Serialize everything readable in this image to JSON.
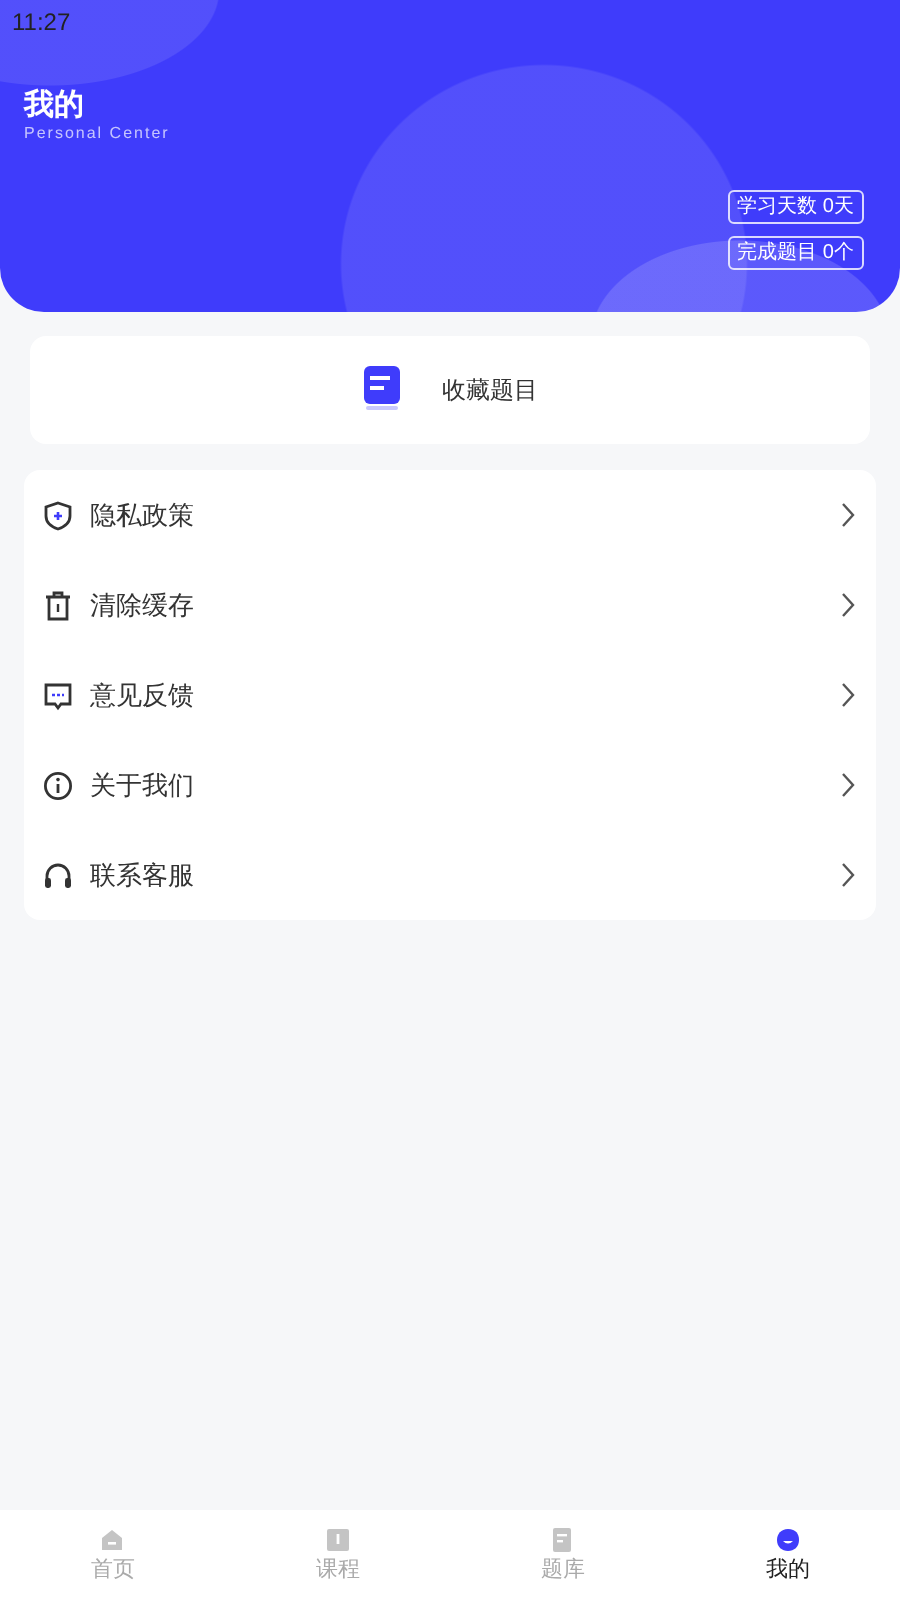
{
  "status_bar": {
    "time": "11:27"
  },
  "header": {
    "title": "我的",
    "subtitle": "Personal Center",
    "stats": [
      "学习天数 0天",
      "完成题目 0个"
    ]
  },
  "favorites": {
    "label": "收藏题目"
  },
  "menu": [
    {
      "kind": "shield",
      "label": "隐私政策"
    },
    {
      "kind": "trash",
      "label": "清除缓存"
    },
    {
      "kind": "chat",
      "label": "意见反馈"
    },
    {
      "kind": "info",
      "label": "关于我们"
    },
    {
      "kind": "headset",
      "label": "联系客服"
    }
  ],
  "tabs": [
    {
      "kind": "home",
      "label": "首页",
      "selected": false
    },
    {
      "kind": "course",
      "label": "课程",
      "selected": false
    },
    {
      "kind": "bank",
      "label": "题库",
      "selected": false
    },
    {
      "kind": "me",
      "label": "我的",
      "selected": true
    }
  ]
}
